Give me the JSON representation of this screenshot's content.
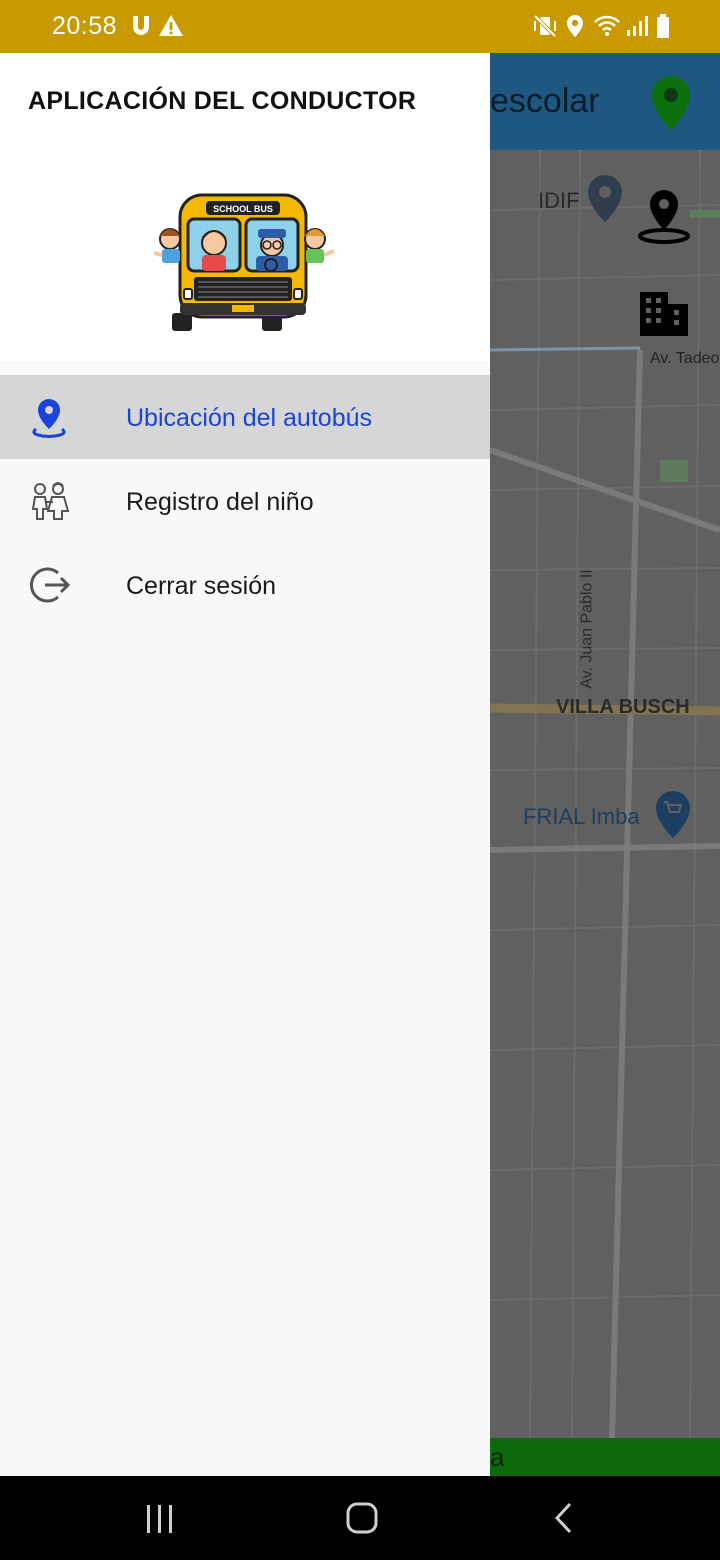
{
  "status_bar": {
    "time": "20:58",
    "left_icons": [
      "u-notification-icon",
      "warning-icon"
    ],
    "right_icons": [
      "mute-vibrate-icon",
      "location-icon",
      "wifi-icon",
      "signal-icon",
      "battery-icon"
    ]
  },
  "background_app": {
    "title_fragment": "escolar",
    "bottom_fragment": "a",
    "map_labels": {
      "idif": "IDIF",
      "tadeo": "Av. Tadeo H",
      "juan_pablo": "Av. Juan Pablo II",
      "villa_busch": "VILLA BUSCH",
      "frial": "FRIAL Imba"
    }
  },
  "drawer": {
    "title": "APLICACIÓN DEL CONDUCTOR",
    "logo_text": "SCHOOL BUS",
    "items": [
      {
        "label": "Ubicación del autobús",
        "icon": "location-pin-icon",
        "active": true
      },
      {
        "label": "Registro del niño",
        "icon": "children-icon",
        "active": false
      },
      {
        "label": "Cerrar sesión",
        "icon": "logout-icon",
        "active": false
      }
    ]
  },
  "colors": {
    "status_bar": "#c99a00",
    "active_item_bg": "#d6d6d6",
    "active_item_text": "#1a44d8",
    "drawer_bg": "#f8f8f8"
  }
}
